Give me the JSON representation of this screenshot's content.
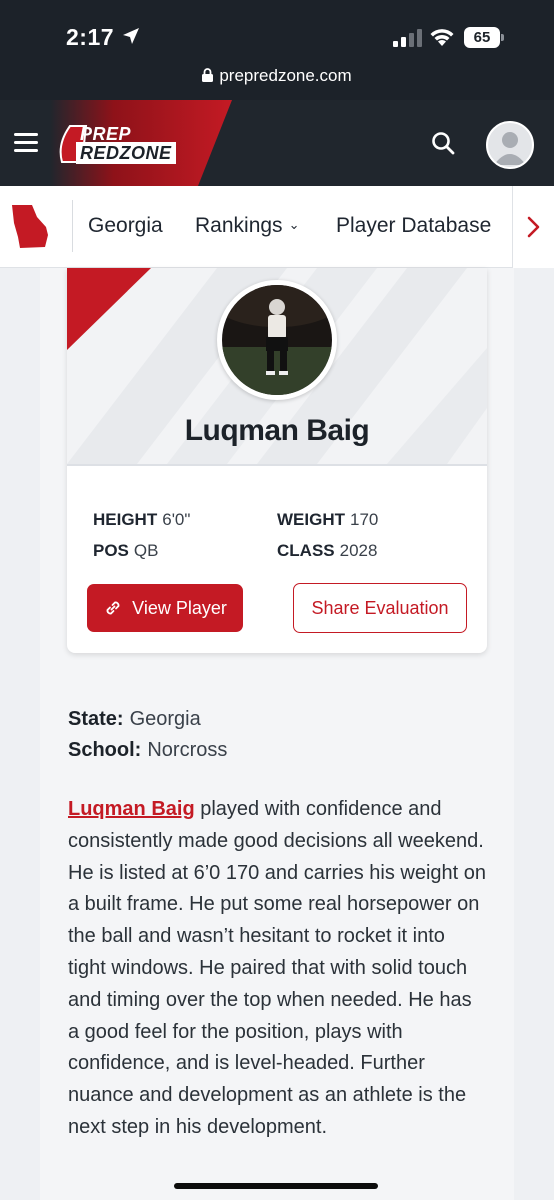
{
  "status_bar": {
    "time": "2:17",
    "battery": "65",
    "url": "prepredzone.com"
  },
  "header": {
    "logo_top": "PREP",
    "logo_bottom": "REDZONE",
    "brand_red": "#c41a24",
    "header_bg": "#20262d"
  },
  "nav": {
    "items": [
      {
        "label": "Georgia"
      },
      {
        "label": "Rankings"
      },
      {
        "label": "Player Database"
      }
    ],
    "rankings_caret": "⌄"
  },
  "player": {
    "name": "Luqman Baig",
    "stats": [
      {
        "key": "HEIGHT",
        "value": "6'0\""
      },
      {
        "key": "WEIGHT",
        "value": "170"
      },
      {
        "key": "POS",
        "value": "QB"
      },
      {
        "key": "CLASS",
        "value": "2028"
      }
    ],
    "view_button": "View Player",
    "share_button": "Share Evaluation"
  },
  "info": {
    "state_label": "State:",
    "state_value": "Georgia",
    "school_label": "School:",
    "school_value": "Norcross"
  },
  "article": {
    "name_link": "Luqman Baig",
    "body": " played with confidence and consistently made good decisions all weekend. He is listed at 6’0 170 and carries his weight on a built frame. He put some real horsepower on the ball and wasn’t hesitant to rocket it into tight windows. He paired that with solid touch and timing over the top when needed. He has a good feel for the position, plays with confidence, and is level-headed. Further nuance and development as an athlete is the next step in his development."
  }
}
